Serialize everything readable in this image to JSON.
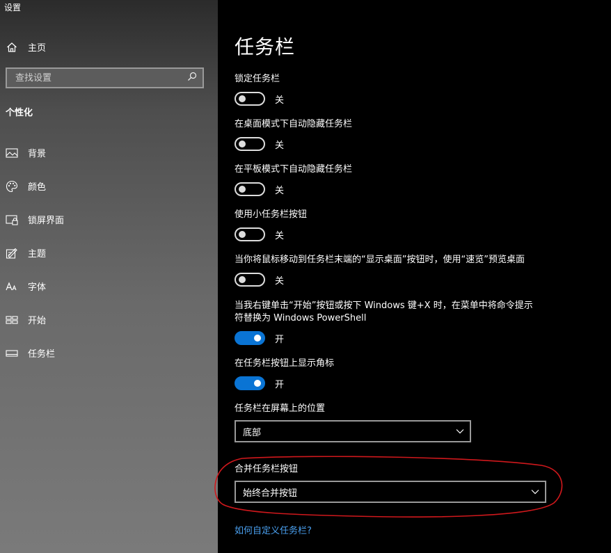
{
  "window": {
    "title": "设置"
  },
  "sidebar": {
    "home_label": "主页",
    "search_placeholder": "查找设置",
    "section_title": "个性化",
    "items": [
      {
        "label": "背景",
        "icon": "picture-icon"
      },
      {
        "label": "颜色",
        "icon": "palette-icon"
      },
      {
        "label": "锁屏界面",
        "icon": "lock-screen-icon"
      },
      {
        "label": "主题",
        "icon": "theme-icon"
      },
      {
        "label": "字体",
        "icon": "font-icon"
      },
      {
        "label": "开始",
        "icon": "start-icon"
      },
      {
        "label": "任务栏",
        "icon": "taskbar-icon"
      }
    ]
  },
  "main": {
    "title": "任务栏",
    "settings": [
      {
        "label": "锁定任务栏",
        "state": "关",
        "on": false
      },
      {
        "label": "在桌面模式下自动隐藏任务栏",
        "state": "关",
        "on": false
      },
      {
        "label": "在平板模式下自动隐藏任务栏",
        "state": "关",
        "on": false
      },
      {
        "label": "使用小任务栏按钮",
        "state": "关",
        "on": false
      },
      {
        "label": "当你将鼠标移动到任务栏末端的“显示桌面”按钮时，使用“速览”预览桌面",
        "state": "关",
        "on": false
      },
      {
        "label": "当我右键单击“开始”按钮或按下 Windows 键+X 时，在菜单中将命令提示符替换为 Windows PowerShell",
        "state": "开",
        "on": true
      },
      {
        "label": "在任务栏按钮上显示角标",
        "state": "开",
        "on": true
      }
    ],
    "position": {
      "label": "任务栏在屏幕上的位置",
      "value": "底部"
    },
    "combine": {
      "label": "合并任务栏按钮",
      "value": "始终合并按钮"
    },
    "help_link": "如何自定义任务栏?"
  },
  "colors": {
    "accent": "#0a74d4",
    "annotation": "#d0181c",
    "link": "#4aa0f0"
  }
}
